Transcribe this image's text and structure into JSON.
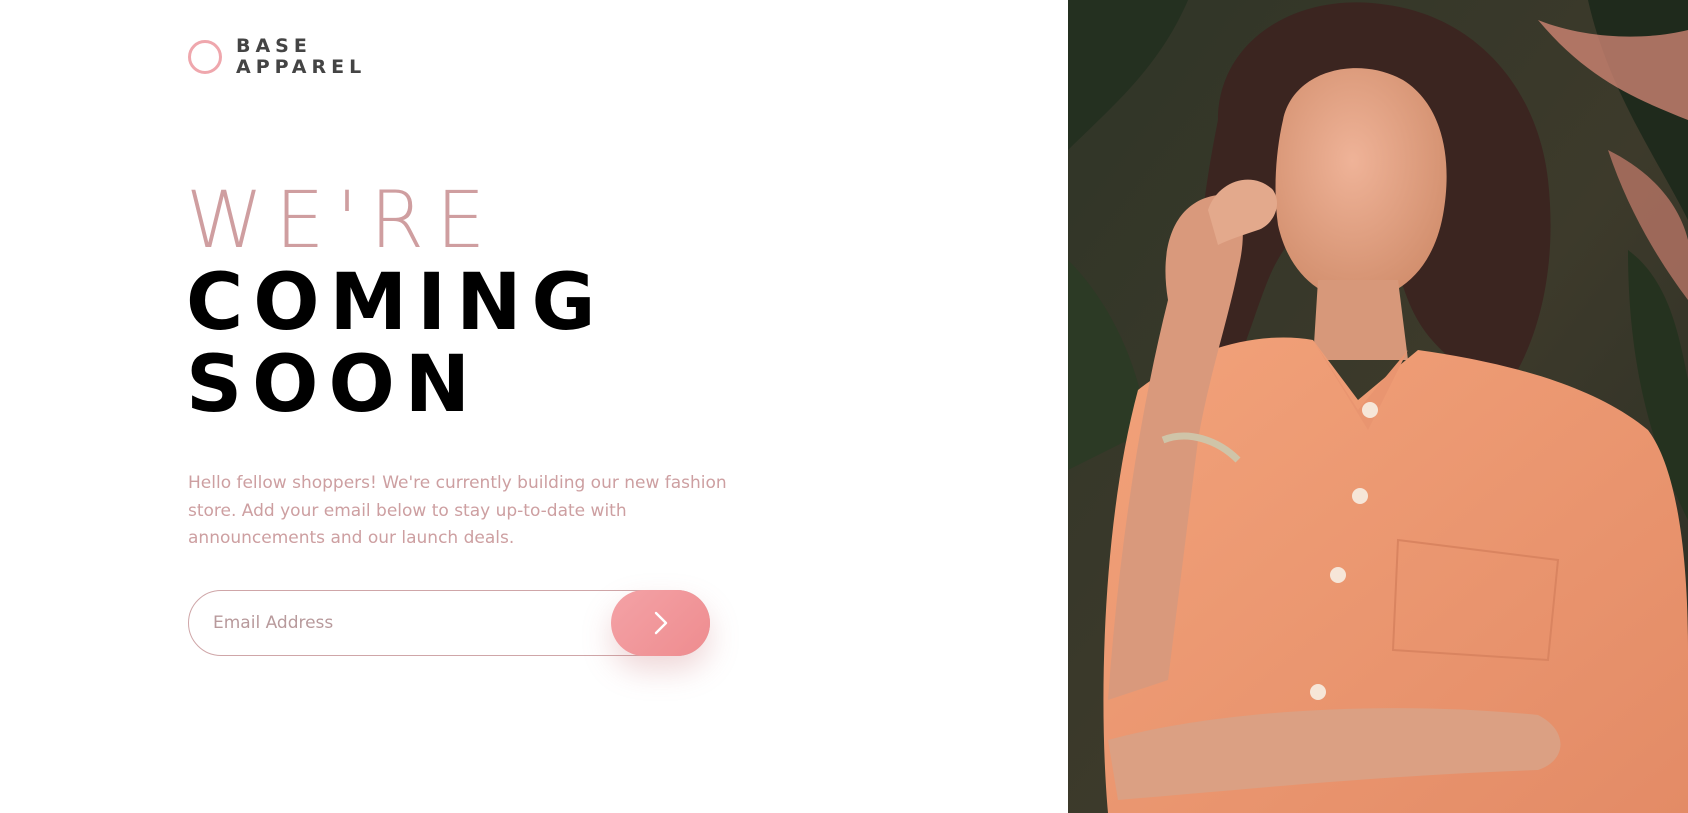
{
  "brand": {
    "line1": "BASE",
    "line2": "APPAREL",
    "accent_color": "#efa7ad"
  },
  "headline": {
    "line1": "WE'RE",
    "line2": "COMING",
    "line3": "SOON"
  },
  "intro": {
    "text": "Hello fellow shoppers! We're currently building our new fashion store. Add your email below to stay up-to-date with announcements and our launch deals."
  },
  "signup": {
    "placeholder": "Email Address",
    "button_icon": "chevron-right-icon"
  },
  "colors": {
    "headline_thin": "#cf9ea0",
    "headline_bold": "#000000",
    "body_text": "#cd9fa1",
    "button": "#ee8c8f"
  },
  "hero": {
    "icon": "model-photo"
  }
}
